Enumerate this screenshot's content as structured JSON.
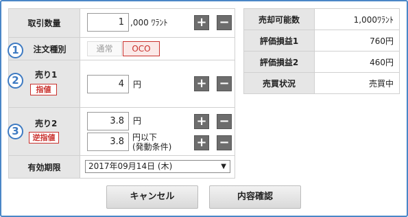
{
  "order": {
    "quantity": {
      "label": "取引数量",
      "value": "1",
      "unit": ",000 ﾜﾗﾝﾄ"
    },
    "type": {
      "number": "1",
      "label": "注文種別",
      "options": [
        "通常",
        "OCO"
      ],
      "selected": "OCO"
    },
    "sell1": {
      "number": "2",
      "label": "売り1",
      "badge": "指値",
      "value": "4",
      "unit": "円"
    },
    "sell2": {
      "number": "3",
      "label": "売り2",
      "badge": "逆指値",
      "value": "3.8",
      "unit": "円",
      "trigger_value": "3.8",
      "trigger_unit_line1": "円以下",
      "trigger_unit_line2": "(発動条件)"
    },
    "expiry": {
      "label": "有効期限",
      "value": "2017年09月14日 (木)"
    }
  },
  "summary": [
    {
      "key": "売却可能数",
      "value": "1,000ﾜﾗﾝﾄ"
    },
    {
      "key": "評価損益1",
      "value": "760円"
    },
    {
      "key": "評価損益2",
      "value": "460円"
    },
    {
      "key": "売買状況",
      "value": "売買中"
    }
  ],
  "buttons": {
    "plus": "+",
    "minus": "−",
    "cancel": "キャンセル",
    "confirm": "内容確認"
  },
  "colors": {
    "frame": "#4a86c7",
    "badge": "#c9302c",
    "oco": "#c9302c",
    "circle": "#3d7ac2"
  }
}
